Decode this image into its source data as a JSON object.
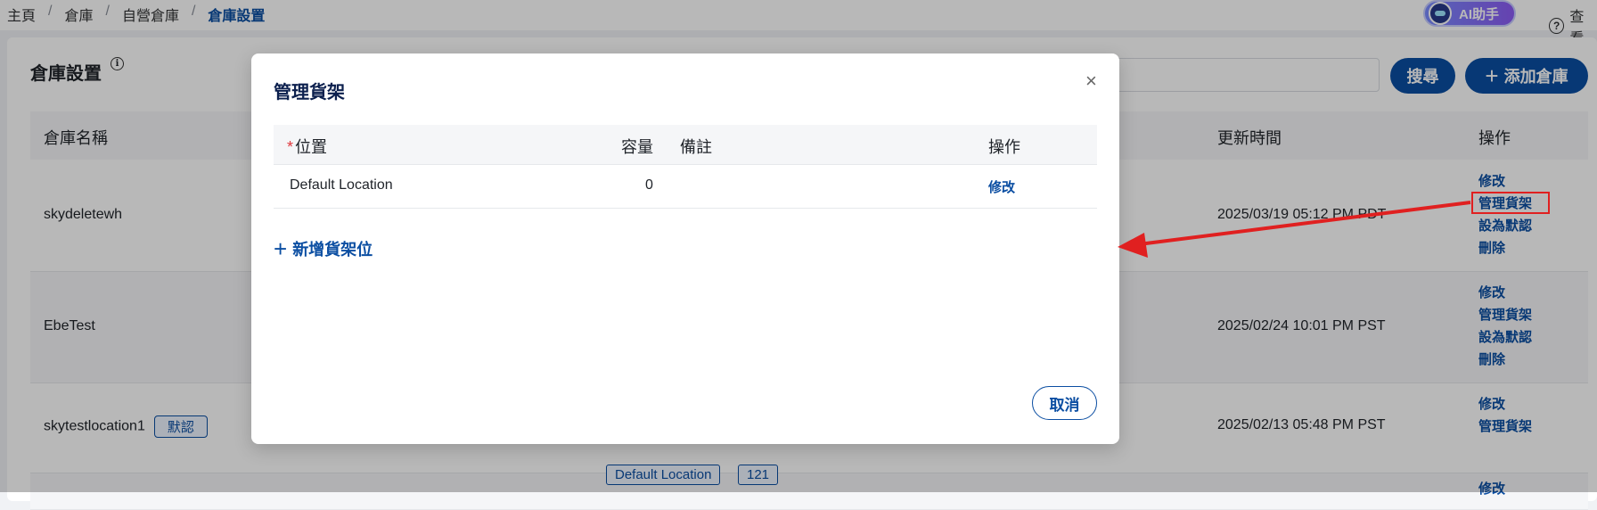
{
  "breadcrumb": [
    "主頁",
    "倉庫",
    "自營倉庫",
    "倉庫設置"
  ],
  "breadcrumb_sep": "/",
  "header": {
    "ai_label": "AI助手",
    "help_label": "查看",
    "help_icon": "?"
  },
  "page": {
    "title": "倉庫設置",
    "info_icon": "i",
    "search_label": "搜尋",
    "add_label": "添加倉庫",
    "add_icon": "+"
  },
  "table": {
    "headers": {
      "name": "倉庫名稱",
      "updated": "更新時間",
      "actions": "操作"
    },
    "rows": [
      {
        "name": "skydeletewh",
        "badge": "",
        "time": "2025/03/19 05:12 PM PDT",
        "actions": [
          "修改",
          "管理貨架",
          "設為默認",
          "刪除"
        ]
      },
      {
        "name": "EbeTest",
        "badge": "",
        "time": "2025/02/24 10:01 PM PST",
        "actions": [
          "修改",
          "管理貨架",
          "設為默認",
          "刪除"
        ]
      },
      {
        "name": "skytestlocation1",
        "badge": "默認",
        "time": "2025/02/13 05:48 PM PST",
        "actions": [
          "修改",
          "管理貨架"
        ]
      },
      {
        "name": "",
        "badge": "",
        "time": "",
        "actions": [
          "修改"
        ],
        "tags": [
          "Default Location",
          "121"
        ]
      }
    ]
  },
  "modal": {
    "title": "管理貨架",
    "close_icon": "×",
    "required_mark": "*",
    "headers": {
      "location": "位置",
      "capacity": "容量",
      "note": "備註",
      "action": "操作"
    },
    "rows": [
      {
        "location": "Default Location",
        "capacity": "0",
        "note": "",
        "action": "修改"
      }
    ],
    "add_label": "新增貨架位",
    "add_icon": "+",
    "cancel_label": "取消"
  },
  "annotation": {
    "highlight_color": "#e02020",
    "arrow_color": "#e02020"
  },
  "colors": {
    "primary": "#0b4ea2",
    "required": "#e0393e"
  }
}
